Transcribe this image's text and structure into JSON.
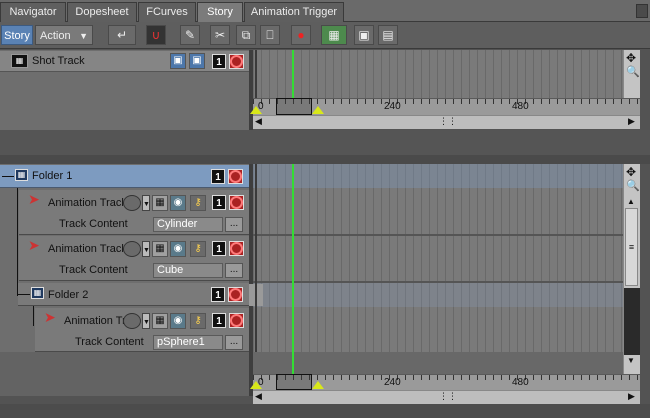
{
  "tabs": [
    {
      "label": "Navigator"
    },
    {
      "label": "Dopesheet"
    },
    {
      "label": "FCurves"
    },
    {
      "label": "Story",
      "active": true
    },
    {
      "label": "Animation Trigger"
    }
  ],
  "toolbar": {
    "mode_label": "Story",
    "action_label": "Action"
  },
  "shot_track": {
    "label": "Shot Track",
    "solo_number": "1"
  },
  "ruler": {
    "ticks": [
      "0",
      "240",
      "480"
    ]
  },
  "folders": [
    {
      "label": "Folder 1",
      "solo_number": "1"
    },
    {
      "label": "Folder 2",
      "solo_number": "1"
    }
  ],
  "tracks": [
    {
      "label": "Animation Track",
      "solo_number": "1",
      "content_label": "Track Content",
      "content_value": "Cylinder",
      "browse_label": "..."
    },
    {
      "label": "Animation Track",
      "solo_number": "1",
      "content_label": "Track Content",
      "content_value": "Cube",
      "browse_label": "..."
    },
    {
      "label": "Animation Tr",
      "solo_number": "1",
      "content_label": "Track Content",
      "content_value": "pSphere1",
      "browse_label": "..."
    }
  ],
  "colors": {
    "playhead": "#33dd33",
    "folder_header": "#7d9bc0",
    "mute_red": "#aa2222",
    "marker_yellow": "#d8e81a"
  }
}
